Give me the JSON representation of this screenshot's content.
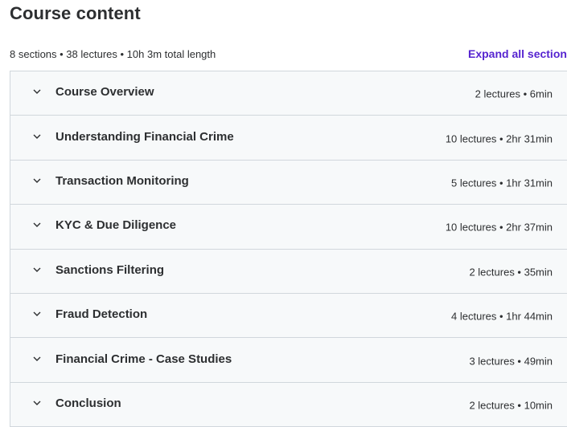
{
  "header": {
    "title": "Course content",
    "summary": "8 sections • 38 lectures • 10h 3m total length",
    "expand_all_label": "Expand all sections"
  },
  "colors": {
    "link": "#5624d0",
    "text": "#2d2f31",
    "row_background": "#f7f9fa",
    "border": "#d1d7dc"
  },
  "sections": [
    {
      "title": "Course Overview",
      "meta": "2 lectures • 6min",
      "icon": "chevron-down-icon"
    },
    {
      "title": "Understanding Financial Crime",
      "meta": "10 lectures • 2hr 31min",
      "icon": "chevron-down-icon"
    },
    {
      "title": "Transaction Monitoring",
      "meta": "5 lectures • 1hr 31min",
      "icon": "chevron-down-icon"
    },
    {
      "title": "KYC & Due Diligence",
      "meta": "10 lectures • 2hr 37min",
      "icon": "chevron-down-icon"
    },
    {
      "title": "Sanctions Filtering",
      "meta": "2 lectures • 35min",
      "icon": "chevron-down-icon"
    },
    {
      "title": "Fraud Detection",
      "meta": "4 lectures • 1hr 44min",
      "icon": "chevron-down-icon"
    },
    {
      "title": "Financial Crime - Case Studies",
      "meta": "3 lectures • 49min",
      "icon": "chevron-down-icon"
    },
    {
      "title": "Conclusion",
      "meta": "2 lectures • 10min",
      "icon": "chevron-down-icon"
    }
  ]
}
